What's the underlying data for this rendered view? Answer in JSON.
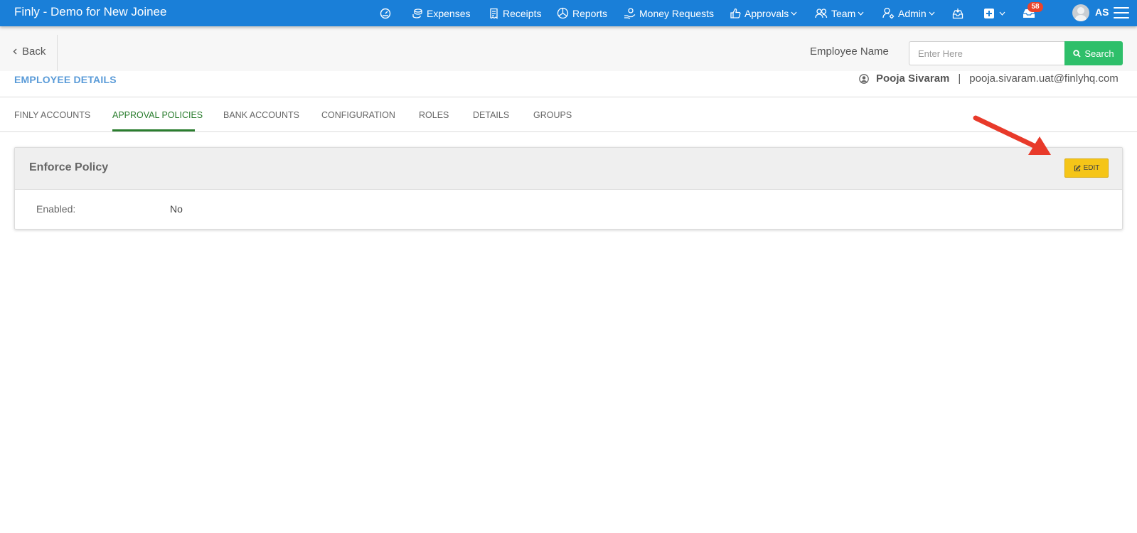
{
  "app": {
    "title": "Finly - Demo for New Joinee"
  },
  "nav": {
    "dashboard_icon": "gauge-icon",
    "items": [
      {
        "label": "Expenses",
        "icon": "coins-icon"
      },
      {
        "label": "Receipts",
        "icon": "receipt-icon"
      },
      {
        "label": "Reports",
        "icon": "pie-chart-icon"
      },
      {
        "label": "Money Requests",
        "icon": "hand-money-icon"
      },
      {
        "label": "Approvals",
        "icon": "thumbs-up-icon",
        "dropdown": true
      },
      {
        "label": "Team",
        "icon": "users-icon",
        "dropdown": true
      },
      {
        "label": "Admin",
        "icon": "user-gear-icon",
        "dropdown": true
      }
    ],
    "notification_count": "58",
    "user_initials": "AS"
  },
  "subheader": {
    "back_label": "Back",
    "employee_name_label": "Employee Name",
    "search_placeholder": "Enter Here",
    "search_button": "Search"
  },
  "employee": {
    "section_title": "EMPLOYEE DETAILS",
    "name": "Pooja Sivaram",
    "separator": "|",
    "email": "pooja.sivaram.uat@finlyhq.com"
  },
  "tabs": [
    {
      "label": "FINLY ACCOUNTS",
      "active": false
    },
    {
      "label": "APPROVAL POLICIES",
      "active": true
    },
    {
      "label": "BANK ACCOUNTS",
      "active": false
    },
    {
      "label": "CONFIGURATION",
      "active": false
    },
    {
      "label": "ROLES",
      "active": false
    },
    {
      "label": "DETAILS",
      "active": false
    },
    {
      "label": "GROUPS",
      "active": false
    }
  ],
  "policy_card": {
    "title": "Enforce Policy",
    "edit_label": "EDIT",
    "field_label": "Enabled:",
    "field_value": "No"
  },
  "colors": {
    "topbar": "#1a7fd8",
    "active_tab": "#2a7d2e",
    "search_button": "#2ebf6a",
    "edit_button": "#f5c518",
    "section_title": "#5a9bd8",
    "badge": "#e8442c",
    "annotation_arrow": "#e83a2a"
  }
}
